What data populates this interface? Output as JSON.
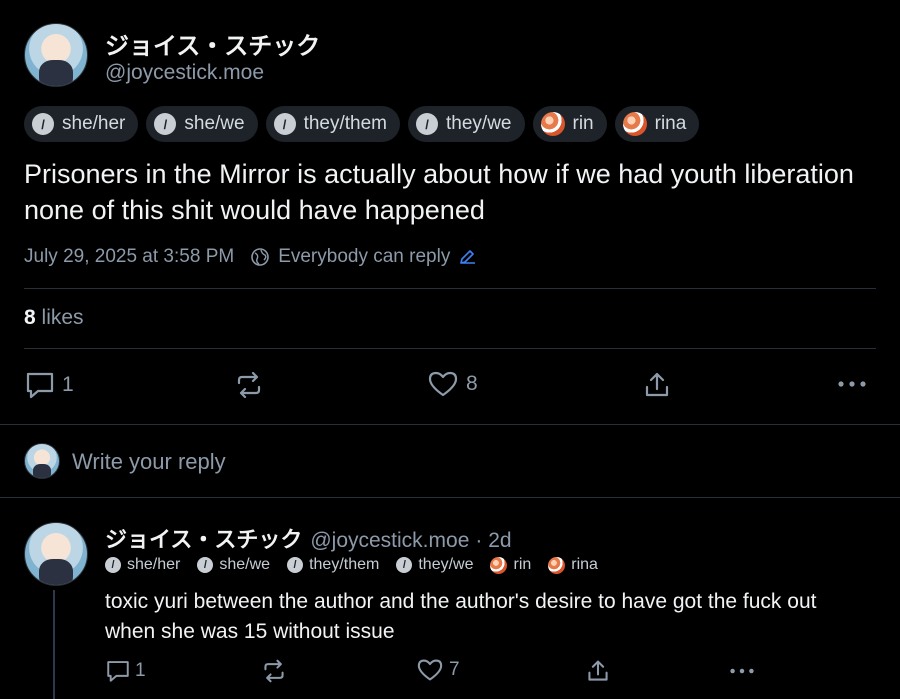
{
  "post": {
    "author_name": "ジョイス・スチック",
    "handle": "@joycestick.moe",
    "pronoun_tags": [
      {
        "label": "she/her",
        "icon": "slash-badge-icon"
      },
      {
        "label": "she/we",
        "icon": "slash-badge-icon"
      },
      {
        "label": "they/them",
        "icon": "slash-badge-icon"
      },
      {
        "label": "they/we",
        "icon": "slash-badge-icon"
      },
      {
        "label": "rin",
        "icon": "flower-badge-icon"
      },
      {
        "label": "rina",
        "icon": "flower-badge-icon"
      }
    ],
    "text": "Prisoners in the Mirror is actually about how if we had youth liberation none of this shit would have happened",
    "timestamp": "July 29, 2025 at 3:58 PM",
    "reply_setting": "Everybody can reply",
    "likes_count": "8",
    "likes_label": "likes",
    "actions": {
      "reply_count": "1",
      "like_count": "8"
    }
  },
  "reply_box": {
    "placeholder": "Write your reply"
  },
  "comment": {
    "author_name": "ジョイス・スチック",
    "handle": "@joycestick.moe",
    "age": "· 2d",
    "pronoun_tags": [
      {
        "label": "she/her",
        "icon": "slash-badge-icon"
      },
      {
        "label": "she/we",
        "icon": "slash-badge-icon"
      },
      {
        "label": "they/them",
        "icon": "slash-badge-icon"
      },
      {
        "label": "they/we",
        "icon": "slash-badge-icon"
      },
      {
        "label": "rin",
        "icon": "flower-badge-icon"
      },
      {
        "label": "rina",
        "icon": "flower-badge-icon"
      }
    ],
    "text": "toxic yuri between the author and the author's desire to have got the fuck out when she was 15 without issue",
    "actions": {
      "reply_count": "1",
      "like_count": "7"
    }
  },
  "colors": {
    "background": "#000000",
    "muted": "#8d9aa9",
    "accent": "#3c82f6",
    "divider": "#2a2f36"
  }
}
